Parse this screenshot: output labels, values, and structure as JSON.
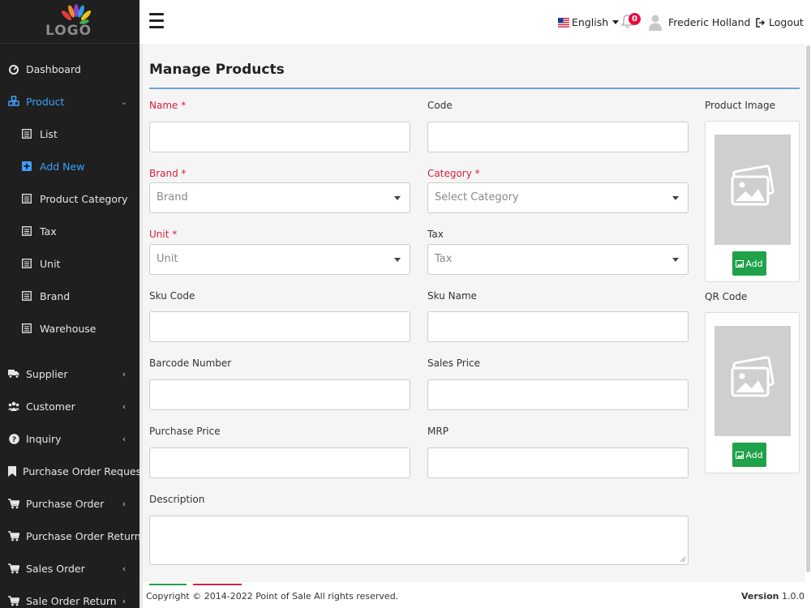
{
  "logo": {
    "text": "LOGO"
  },
  "sidebar": {
    "items": [
      {
        "label": "Dashboard",
        "icon": "dashboard-icon"
      },
      {
        "label": "Product",
        "icon": "product-icon"
      },
      {
        "label": "Supplier",
        "icon": "truck-icon"
      },
      {
        "label": "Customer",
        "icon": "users-icon"
      },
      {
        "label": "Inquiry",
        "icon": "question-icon"
      },
      {
        "label": "Purchase Order Request",
        "icon": "bookmark-icon"
      },
      {
        "label": "Purchase Order",
        "icon": "cart-icon"
      },
      {
        "label": "Purchase Order Return",
        "icon": "cart-icon"
      },
      {
        "label": "Sales Order",
        "icon": "cart-icon"
      },
      {
        "label": "Sale Order Return",
        "icon": "cart-icon"
      }
    ],
    "product_sub": [
      {
        "label": "List"
      },
      {
        "label": "Add New"
      },
      {
        "label": "Product Category"
      },
      {
        "label": "Tax"
      },
      {
        "label": "Unit"
      },
      {
        "label": "Brand"
      },
      {
        "label": "Warehouse"
      }
    ]
  },
  "topbar": {
    "language": "English",
    "notifications": "0",
    "user": "Frederic Holland",
    "logout": "Logout"
  },
  "form": {
    "title": "Manage Products",
    "name_label": "Name *",
    "code_label": "Code",
    "brand_label": "Brand *",
    "brand_value": "Brand",
    "category_label": "Category *",
    "category_value": "Select Category",
    "unit_label": "Unit *",
    "unit_value": "Unit",
    "tax_label": "Tax",
    "tax_value": "Tax",
    "sku_code_label": "Sku Code",
    "sku_name_label": "Sku Name",
    "barcode_label": "Barcode Number",
    "sales_price_label": "Sales Price",
    "purchase_price_label": "Purchase Price",
    "mrp_label": "MRP",
    "description_label": "Description",
    "product_image_label": "Product Image",
    "qr_code_label": "QR Code",
    "add_label": "Add"
  },
  "footer": {
    "copyright": "Copyright © 2014-2022 Point of Sale All rights reserved.",
    "version_label": "Version",
    "version_value": "1.0.0"
  },
  "colors": {
    "sidebar_bg": "#1f1f1f",
    "active": "#3ea0ff",
    "required": "#d6213c",
    "add_button": "#1fa24a",
    "badge": "#e3103e"
  }
}
